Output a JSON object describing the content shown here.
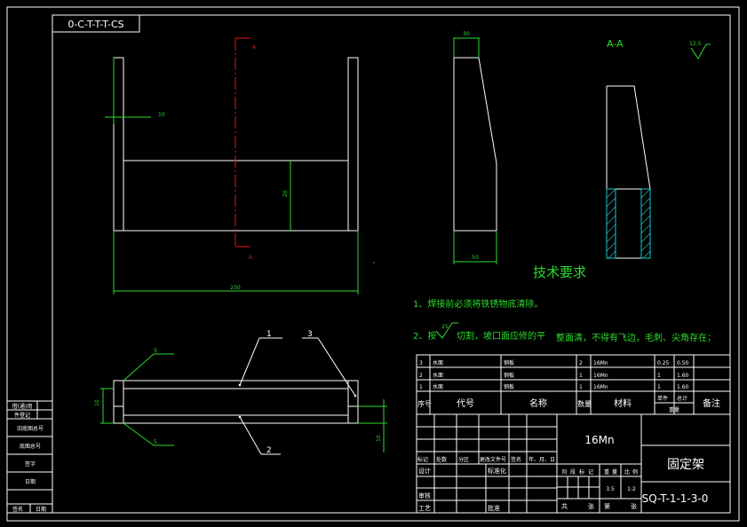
{
  "drawing_code_top": "0-C-T-T-T-CS",
  "section_label": "A-A",
  "roughness_value": "12.5",
  "section_mark": "A",
  "dims": {
    "front_width": "10",
    "front_inner_height": "20",
    "front_total_length": "250",
    "side_top": "30",
    "side_bottom": "50",
    "bottom_left_top": "5",
    "bottom_left_bottom": "5",
    "bottom_height": "10",
    "bottom_right": "10"
  },
  "balloons": [
    "1",
    "3",
    "2"
  ],
  "tech_title": "技术要求",
  "tech_note_1": "1、焊接前必须将铁锈物底清除。",
  "tech_note_2a": "2、按",
  "tech_note_2_rough": "25",
  "tech_note_2b": "切割，坡口面应修的平",
  "tech_note_2c": "整面清，不得有飞边，毛刺、尖角存在；",
  "bom": {
    "rows": [
      {
        "no": "3",
        "code": "水面",
        "name": "钢板",
        "qty": "2",
        "mat": "16Mn",
        "w1": "0.25",
        "w2": "0.50"
      },
      {
        "no": "2",
        "code": "水面",
        "name": "钢板",
        "qty": "1",
        "mat": "16Mn",
        "w1": "1",
        "w2": "1.60"
      },
      {
        "no": "1",
        "code": "水面",
        "name": "钢板",
        "qty": "1",
        "mat": "16Mn",
        "w1": "1",
        "w2": "1.60"
      }
    ],
    "headers": {
      "seq": "序号",
      "code": "代号",
      "name": "名称",
      "qty": "数量",
      "mat": "材料",
      "unit": "单件",
      "total": "总计",
      "weight": "重量",
      "remark": "备注"
    }
  },
  "title_block": {
    "material": "16Mn",
    "part_name": "固定架",
    "drawing_no": "SQ-T-1-1-3-0",
    "scale": "1:2",
    "weight": "3.5",
    "stage_labels": [
      "阶",
      "段",
      "标",
      "记",
      "重",
      "量",
      "比",
      "例"
    ],
    "sheets": [
      "共",
      "张",
      "第",
      "张"
    ],
    "rev_cols": [
      "标记",
      "处数",
      "分区",
      "更改文件号",
      "签名",
      "年、月、日"
    ],
    "roles": [
      "设计",
      "标准化",
      "审核",
      "工艺",
      "批准"
    ]
  },
  "side_strip": [
    "借(通)用",
    "件登记",
    "旧底图总号",
    "底图总号",
    "签字",
    "日期",
    "签名",
    "日期"
  ]
}
